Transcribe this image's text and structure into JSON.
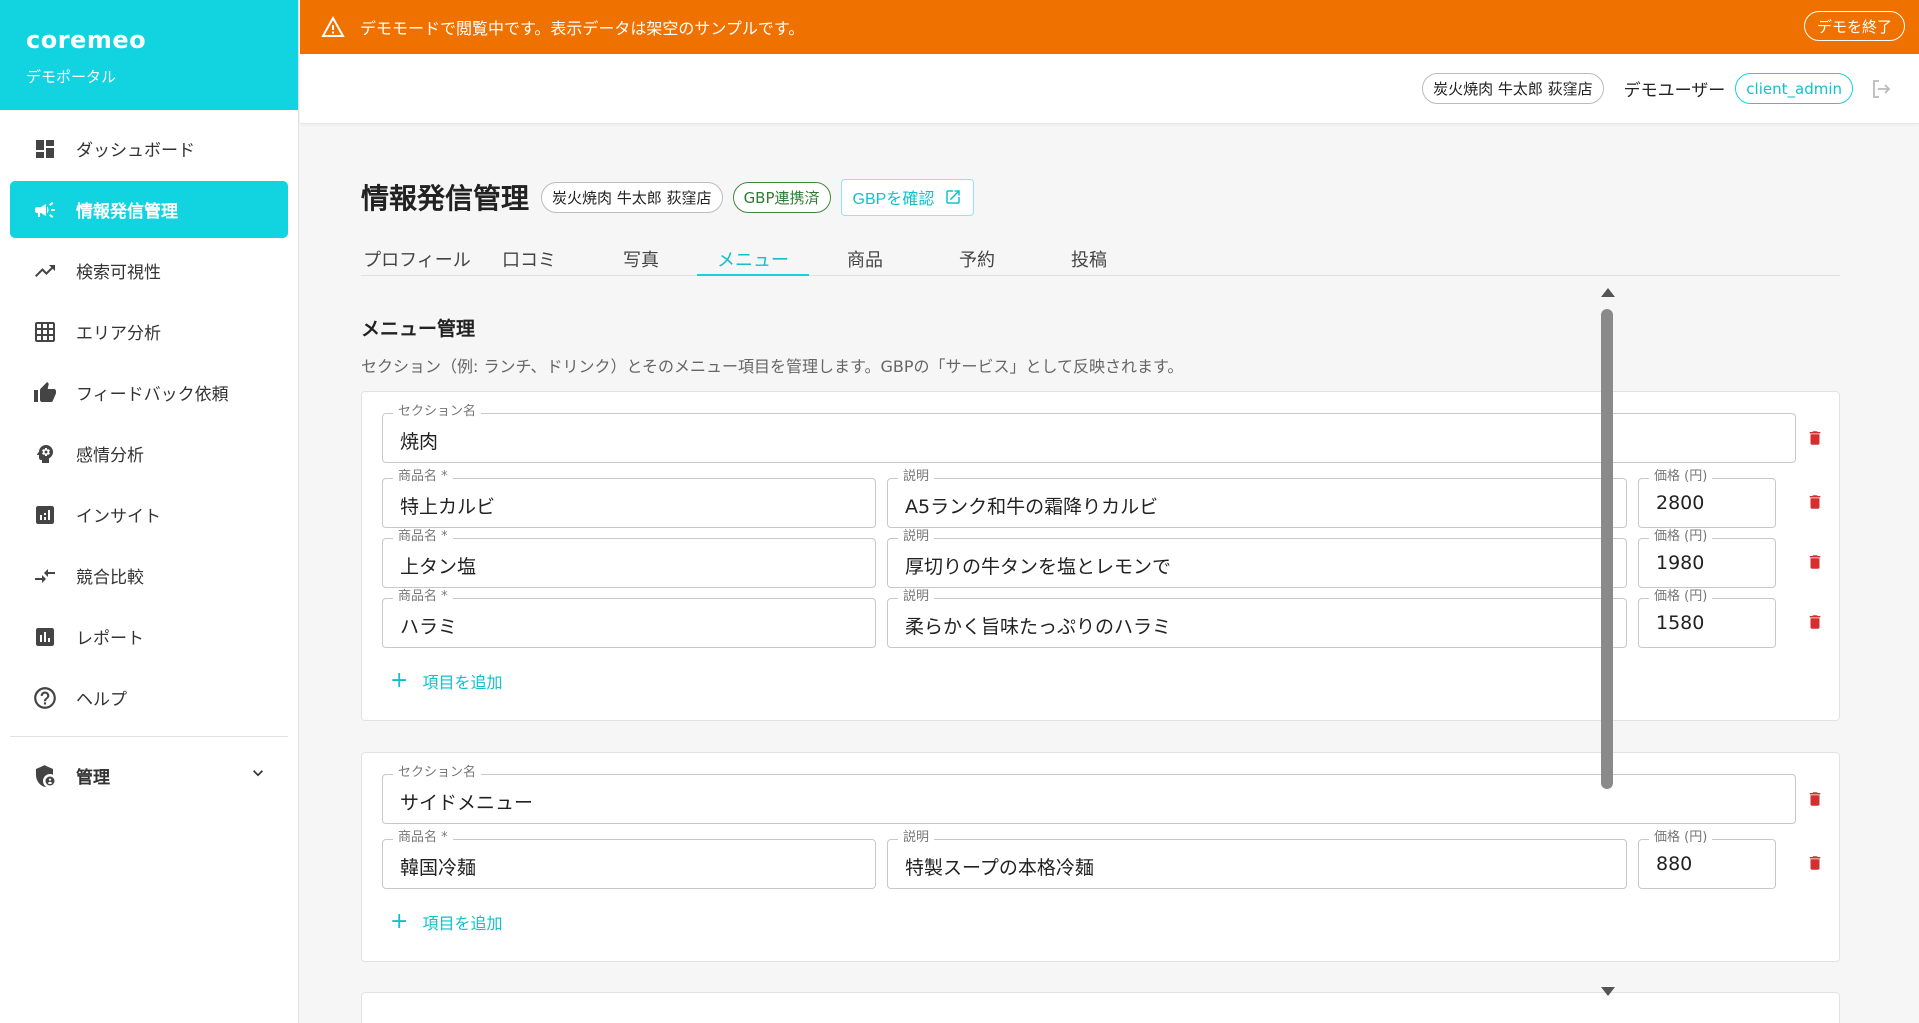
{
  "brand": {
    "name": "coremeo",
    "sub": "デモポータル"
  },
  "nav": [
    {
      "label": "ダッシュボード",
      "icon": "dashboard-icon"
    },
    {
      "label": "情報発信管理",
      "icon": "megaphone-icon"
    },
    {
      "label": "検索可視性",
      "icon": "trending-icon"
    },
    {
      "label": "エリア分析",
      "icon": "grid-icon"
    },
    {
      "label": "フィードバック依頼",
      "icon": "thumbs-up-icon"
    },
    {
      "label": "感情分析",
      "icon": "psychology-icon"
    },
    {
      "label": "インサイト",
      "icon": "insights-icon"
    },
    {
      "label": "競合比較",
      "icon": "compare-icon"
    },
    {
      "label": "レポート",
      "icon": "report-icon"
    },
    {
      "label": "ヘルプ",
      "icon": "help-icon"
    }
  ],
  "nav_admin": {
    "label": "管理",
    "icon": "shield-icon"
  },
  "banner": {
    "text": "デモモードで閲覧中です。表示データは架空のサンプルです。",
    "end_label": "デモを終了"
  },
  "header": {
    "store": "炭火焼肉 牛太郎 荻窪店",
    "user": "デモユーザー",
    "role": "client_admin"
  },
  "page": {
    "title": "情報発信管理",
    "store_chip": "炭火焼肉 牛太郎 荻窪店",
    "gbp_chip": "GBP連携済",
    "gbp_button": "GBPを確認"
  },
  "tabs": [
    "プロフィール",
    "口コミ",
    "写真",
    "メニュー",
    "商品",
    "予約",
    "投稿"
  ],
  "menu": {
    "heading": "メニュー管理",
    "desc": "セクション（例: ランチ、ドリンク）とそのメニュー項目を管理します。GBPの「サービス」として反映されます。",
    "labels": {
      "section": "セクション名",
      "item": "商品名 *",
      "desc": "説明",
      "price": "価格 (円)",
      "add": "項目を追加"
    },
    "sections": [
      {
        "name": "焼肉",
        "items": [
          {
            "name": "特上カルビ",
            "desc": "A5ランク和牛の霜降りカルビ",
            "price": "2800"
          },
          {
            "name": "上タン塩",
            "desc": "厚切りの牛タンを塩とレモンで",
            "price": "1980"
          },
          {
            "name": "ハラミ",
            "desc": "柔らかく旨味たっぷりのハラミ",
            "price": "1580"
          }
        ]
      },
      {
        "name": "サイドメニュー",
        "items": [
          {
            "name": "韓国冷麺",
            "desc": "特製スープの本格冷麺",
            "price": "880"
          }
        ]
      }
    ]
  },
  "colors": {
    "accent": "#12d3e0",
    "banner": "#ef7100",
    "danger": "#d32f2f",
    "success": "#2e7d32"
  }
}
